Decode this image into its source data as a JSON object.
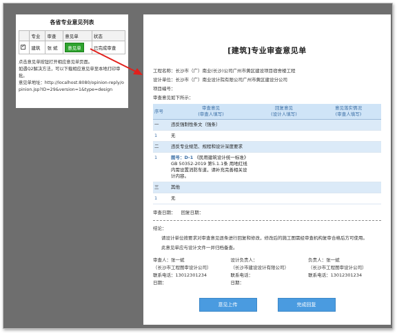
{
  "panel": {
    "title": "各省专业意见列表",
    "headers": [
      "",
      "专业",
      "审查",
      "意见单",
      "状态"
    ],
    "row": {
      "col1": "建筑",
      "col2": "张 斌",
      "button_label": "意见单",
      "status": "已完成审查"
    },
    "note1": "点击意见单按钮打开相应意见单页面。",
    "note2": "如遇Q2解决方法，可以下载相应意见单至本地打印审批。",
    "url_label": "意见单地址：",
    "url": "http://localhost:8080/opinion-reply/opinion.jsp?ID=29&version=1&type=design"
  },
  "doc": {
    "title": "[建筑]专业审查意见单",
    "project_name": "工程名称：长沙市（广）南业(长沙)公司广州市黄区建设项目宿舍楼工程",
    "design_unit": "设计单位：长沙市（广）南业设计院有限公司广州市黄区建设分公司",
    "item_no": "项目编号：",
    "intro": "审查意见如下所示：",
    "table_headers": [
      "序号",
      "审查意见\n(审查人填写)",
      "回复意见\n(设计人填写)",
      "意见落实情况\n(审查人填写)"
    ],
    "sections": [
      {
        "num": "一",
        "label": "违反强制性条文（强条）",
        "rows": [
          {
            "idx": "1",
            "text": "无"
          }
        ]
      },
      {
        "num": "二",
        "label": "违反专业规范、规程和设计深度要求",
        "rows": [
          {
            "idx": "1",
            "link": "图号：D-1",
            "text": "《民用建筑设计统一标准》GB 50352-2019 第5.1.1条 用地红线内需设置消防车道，请补充完善相关设计内容。"
          }
        ]
      },
      {
        "num": "三",
        "label": "其他",
        "rows": [
          {
            "idx": "1",
            "text": "无"
          }
        ]
      }
    ],
    "review_date": "审查日期：",
    "reply_date": "回复日期：",
    "conclusion_label": "结论：",
    "para1": "请设计单位按要求对审查意见逐条进行回复和修改，修改后的施工图需经审查机构复审合格后方可使用。",
    "para2": "此意见单应与设计文件一并归档备查。",
    "sign": {
      "reviewer_title": "审查人：张一斌",
      "reviewer_sub": "（长沙市工程图审设计公司）",
      "reviewer_phone": "联系电话：13012301234",
      "reviewer_date": "日期：",
      "designer_title": "设计负责人：",
      "designer_sub": "（长沙市建设设计有限公司）",
      "designer_phone": "联系电话：",
      "designer_date": "日期：",
      "chief_title": "负责人：张一斌",
      "chief_sub": "（长沙市工程图审设计公司）",
      "chief_phone": "联系电话：13012301234"
    },
    "buttons": {
      "submit": "意见上传",
      "done": "完成回复"
    }
  },
  "colors": {
    "accent_blue": "#4a9be0",
    "header_blue": "#cfe4f7",
    "green": "#2fa32f",
    "arrow_red": "#e2201c"
  }
}
